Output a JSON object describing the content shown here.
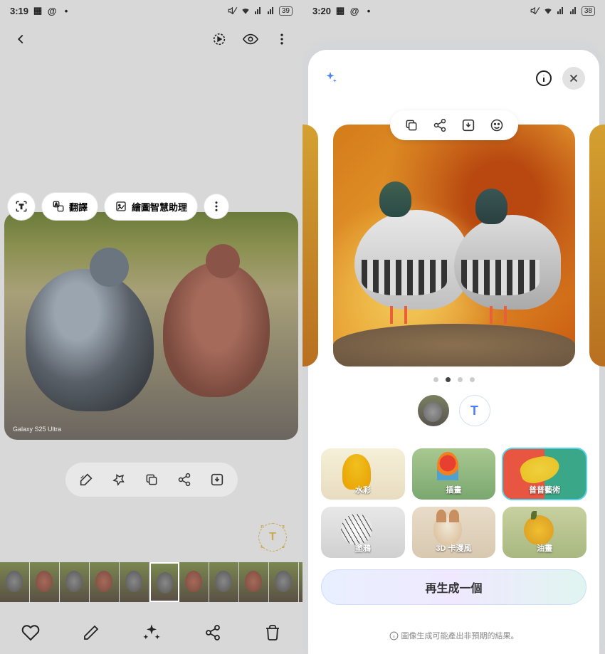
{
  "left": {
    "status": {
      "time": "3:19",
      "battery": "39"
    },
    "chips": {
      "translate": "翻譯",
      "drawing_assist": "繪圖智慧助理"
    },
    "photo": {
      "watermark": "Galaxy S25 Ultra"
    }
  },
  "right": {
    "status": {
      "time": "3:20",
      "battery": "38"
    },
    "pager": {
      "count": 4,
      "active": 1
    },
    "mode_text_label": "T",
    "styles": [
      {
        "label": "水彩"
      },
      {
        "label": "插畫"
      },
      {
        "label": "普普藝術",
        "selected": true
      },
      {
        "label": "塗鴉"
      },
      {
        "label": "3D 卡漫風"
      },
      {
        "label": "油畫"
      }
    ],
    "regenerate": "再生成一個",
    "disclaimer": "圖像生成可能產出非預期的結果。"
  }
}
